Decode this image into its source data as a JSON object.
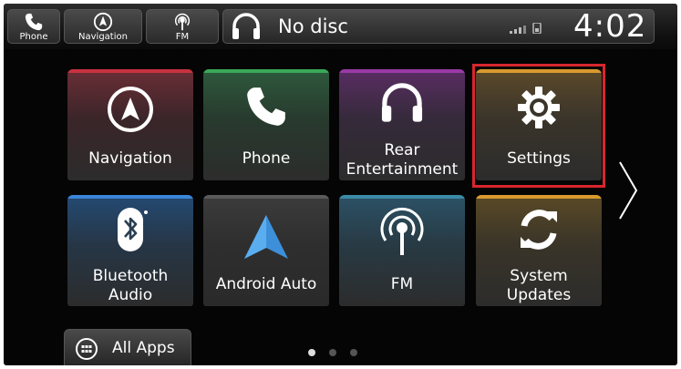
{
  "shortcuts": [
    {
      "label": "Phone",
      "icon": "phone-icon"
    },
    {
      "label": "Navigation",
      "icon": "compass-icon"
    },
    {
      "label": "FM",
      "icon": "antenna-icon"
    }
  ],
  "audio": {
    "source_text": "No disc",
    "icon": "headphones-icon"
  },
  "status": {
    "clock": "4:02",
    "icon": "phone-signal-icon"
  },
  "tiles": [
    {
      "label_lines": [
        "Navigation"
      ],
      "icon": "compass-icon",
      "accent": "#c8323f"
    },
    {
      "label_lines": [
        "Phone"
      ],
      "icon": "phone-icon",
      "accent": "#3aa858"
    },
    {
      "label_lines": [
        "Rear",
        "Entertainment"
      ],
      "icon": "headphones-icon",
      "accent": "#9a3aa6"
    },
    {
      "label_lines": [
        "Settings"
      ],
      "icon": "gear-icon",
      "accent": "#d89a2e"
    },
    {
      "label_lines": [
        "Bluetooth",
        "Audio"
      ],
      "icon": "bluetooth-icon",
      "accent": "#3a86d8"
    },
    {
      "label_lines": [
        "Android Auto"
      ],
      "icon": "android-auto-icon",
      "accent": "#5a5a5a"
    },
    {
      "label_lines": [
        "FM"
      ],
      "icon": "antenna-icon",
      "accent": "#3a8aa6"
    },
    {
      "label_lines": [
        "System",
        "Updates"
      ],
      "icon": "refresh-icon",
      "accent": "#d89a2e"
    }
  ],
  "highlight_color": "#d8262e",
  "all_apps": {
    "label": "All Apps",
    "icon": "grid-icon"
  },
  "pager": {
    "active_page": 1,
    "total_pages": 3
  }
}
